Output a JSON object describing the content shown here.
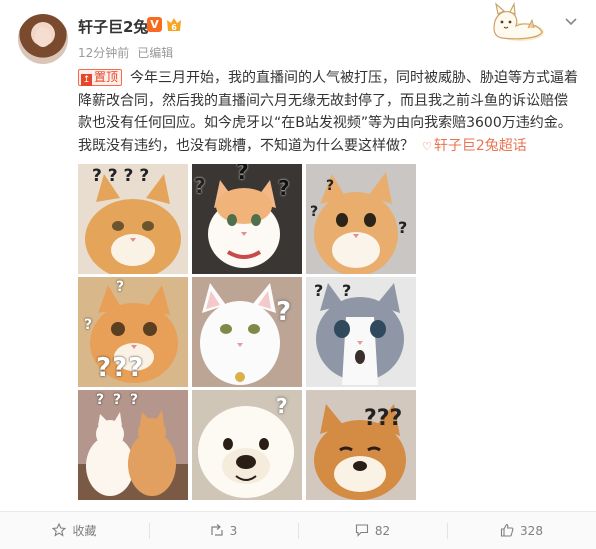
{
  "author": {
    "name": "轩子巨2兔",
    "vip_label": "V",
    "rank_label": "6"
  },
  "meta": {
    "time": "12分钟前",
    "edited": "已编辑"
  },
  "post": {
    "pin_label": "置顶",
    "text": "今年三月开始，我的直播间的人气被打压，同时被威胁、胁迫等方式逼着降薪改合同，然后我的直播间六月无缘无故封停了，而且我之前斗鱼的诉讼赔偿款也没有任何回应。如今虎牙以“在B站发视频”等为由向我索赔3600万违约金。我既没有违约，也没有跳槽，不知道为什么要这样做？",
    "super_topic": "轩子巨2兔超话"
  },
  "images": [
    {
      "alt": "orange-cat-question-1",
      "marks": "? ? ? ?"
    },
    {
      "alt": "white-orange-cat-question",
      "marks": "? ? ?"
    },
    {
      "alt": "orange-cat-question-2",
      "marks": "? ? ?"
    },
    {
      "alt": "orange-cat-question-3",
      "marks": "???"
    },
    {
      "alt": "white-cat-question",
      "marks": "?"
    },
    {
      "alt": "grey-cat-question",
      "marks": "? ?"
    },
    {
      "alt": "two-cats-question",
      "marks": "? ? ?"
    },
    {
      "alt": "white-dog-question",
      "marks": "?"
    },
    {
      "alt": "shiba-question",
      "marks": "???"
    }
  ],
  "actions": {
    "favorite": "收藏",
    "repost": "3",
    "comment": "82",
    "like": "328"
  },
  "colors": {
    "accent": "#eb7350",
    "vip": "#f86b1e",
    "meta_text": "#999999"
  }
}
